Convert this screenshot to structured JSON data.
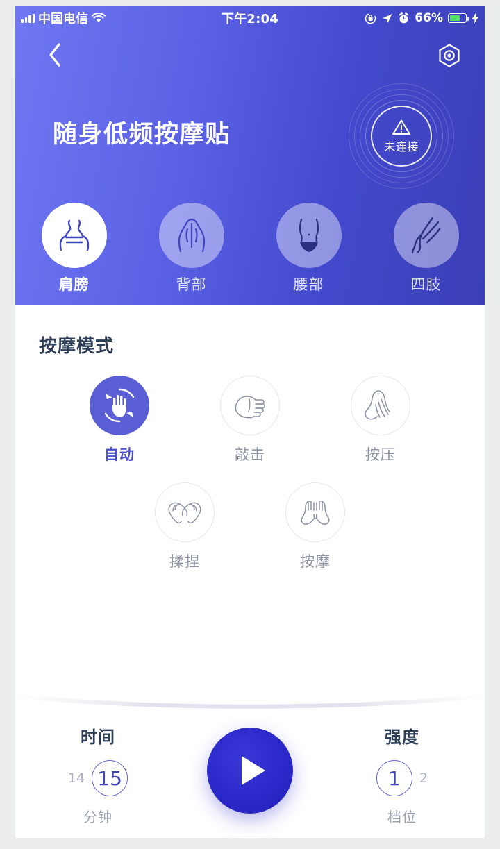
{
  "status_bar": {
    "carrier": "中国电信",
    "signal_icon": "signal-bars-icon",
    "wifi_icon": "wifi-icon",
    "time": "下午2:04",
    "rotation_lock_icon": "rotation-lock-icon",
    "location_icon": "location-arrow-icon",
    "alarm_icon": "alarm-clock-icon",
    "battery_percent": "66%",
    "battery_level": 66,
    "battery_color": "#54e066",
    "charging_icon": "lightning-bolt-icon"
  },
  "nav": {
    "back_icon": "chevron-left-icon",
    "settings_icon": "hex-settings-icon"
  },
  "header": {
    "title": "随身低频按摩贴",
    "gradient_from": "#6f77f2",
    "gradient_to": "#3a3fb6",
    "connection": {
      "label": "未连接",
      "icon": "warning-triangle-icon",
      "connected": false
    }
  },
  "body_parts": [
    {
      "label": "肩膀",
      "icon": "shoulders-icon",
      "selected": true
    },
    {
      "label": "背部",
      "icon": "back-icon",
      "selected": false
    },
    {
      "label": "腰部",
      "icon": "waist-icon",
      "selected": false
    },
    {
      "label": "四肢",
      "icon": "limbs-icon",
      "selected": false
    }
  ],
  "modes": {
    "section_title": "按摩模式",
    "accent_color": "#5b5fd6",
    "row1": [
      {
        "label": "自动",
        "icon": "auto-hand-rotate-icon",
        "selected": true
      },
      {
        "label": "敲击",
        "icon": "fist-tap-icon",
        "selected": false
      },
      {
        "label": "按压",
        "icon": "press-hand-icon",
        "selected": false
      }
    ],
    "row2": [
      {
        "label": "揉捏",
        "icon": "knead-hands-icon",
        "selected": false
      },
      {
        "label": "按摩",
        "icon": "massage-hands-icon",
        "selected": false
      }
    ]
  },
  "controls": {
    "time": {
      "heading": "时间",
      "prev_value": "14",
      "current_value": "15",
      "unit": "分钟"
    },
    "intensity": {
      "heading": "强度",
      "current_value": "1",
      "next_value": "2",
      "unit": "档位"
    },
    "play": {
      "icon": "play-triangle-icon",
      "color": "#2a28c8"
    }
  }
}
